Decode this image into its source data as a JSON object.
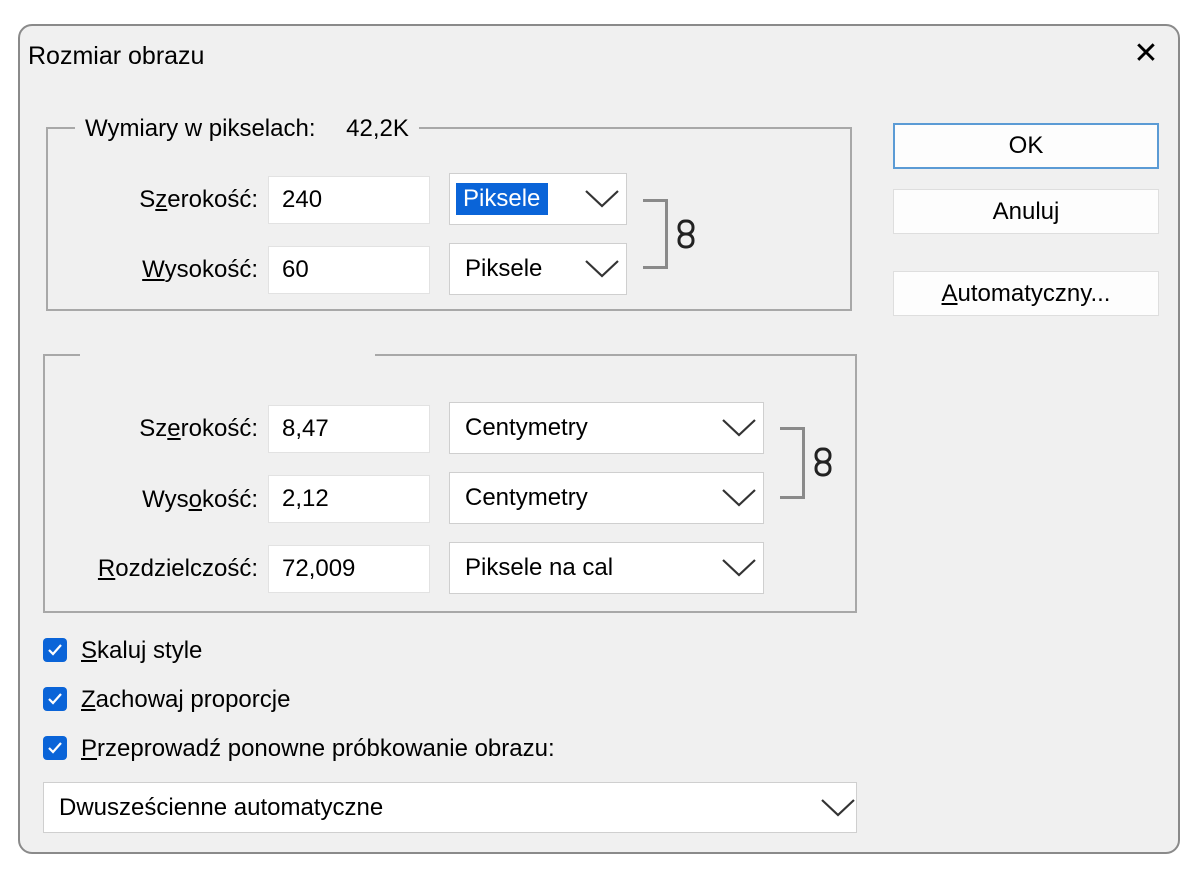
{
  "window": {
    "title": "Rozmiar obrazu",
    "close_glyph": "✕"
  },
  "pixel_dims": {
    "legend_label": "Wymiary w pikselach:",
    "legend_value": "42,2K",
    "width_label_pre": "S",
    "width_label_acc": "z",
    "width_label_post": "erokość:",
    "width_value": "240",
    "width_unit": "Piksele",
    "height_label_acc": "W",
    "height_label_post": "ysokość:",
    "height_value": "60",
    "height_unit": "Piksele",
    "link_icon": "chain-link-icon"
  },
  "doc_size": {
    "width_label_pre": "Sz",
    "width_label_acc": "e",
    "width_label_post": "rokość:",
    "width_value": "8,47",
    "width_unit": "Centymetry",
    "height_label_pre": "Wys",
    "height_label_acc": "o",
    "height_label_post": "kość:",
    "height_value": "2,12",
    "height_unit": "Centymetry",
    "res_label_acc": "R",
    "res_label_post": "ozdzielczość:",
    "res_value": "72,009",
    "res_unit": "Piksele na cal",
    "link_icon": "chain-link-icon"
  },
  "buttons": {
    "ok": "OK",
    "cancel": "Anuluj",
    "auto_acc": "A",
    "auto_post": "utomatyczny..."
  },
  "options": {
    "scale_styles_acc": "S",
    "scale_styles_post": "kaluj style",
    "constrain_acc": "Z",
    "constrain_post": "achowaj proporcje",
    "resample_acc": "P",
    "resample_post": "rzeprowadź ponowne próbkowanie obrazu:",
    "scale_styles_checked": true,
    "constrain_checked": true,
    "resample_checked": true
  },
  "resample_method": "Dwusześcienne automatyczne",
  "colors": {
    "accent": "#0a64d8",
    "dialog_bg": "#f0f0f0",
    "default_button_border": "#5b9bd5"
  }
}
